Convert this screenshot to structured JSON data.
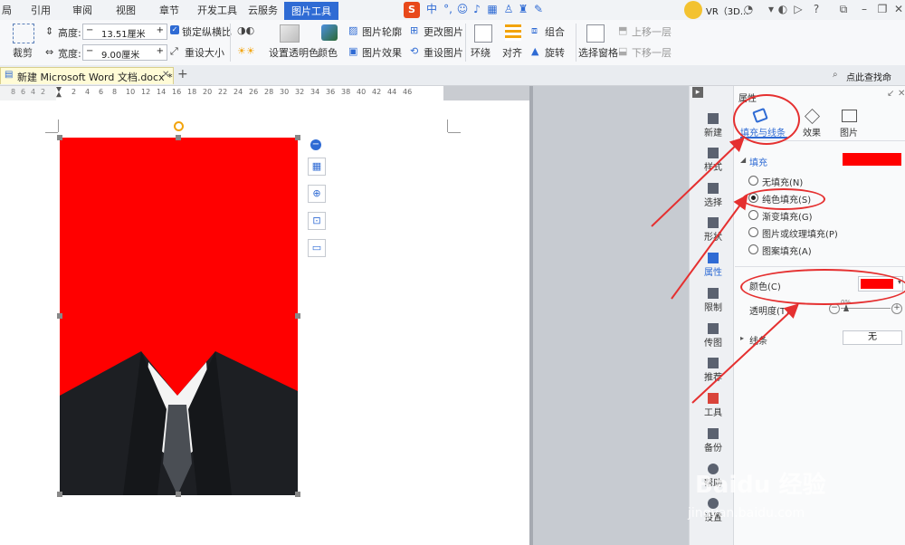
{
  "tabs": [
    "局",
    "引用",
    "审阅",
    "视图",
    "章节",
    "开发工具",
    "云服务",
    "图片工具"
  ],
  "active_tab": "图片工具",
  "user": "VR（3D...",
  "ribbon": {
    "crop": "裁剪",
    "height_label": "高度:",
    "height_value": "13.51厘米",
    "width_label": "宽度:",
    "width_value": "9.00厘米",
    "lock_ratio": "锁定纵横比",
    "reset_size": "重设大小",
    "transparent_color": "设置透明色",
    "color": "颜色",
    "outline": "图片轮廓",
    "effects": "图片效果",
    "change_picture": "更改图片",
    "reset_picture": "重设图片",
    "wrap": "环绕",
    "align": "对齐",
    "group": "组合",
    "rotate": "旋转",
    "selection_pane": "选择窗格",
    "bring_forward": "上移一层",
    "send_backward": "下移一层",
    "search": "点此查找命"
  },
  "doc_tab": "新建 Microsoft Word 文档.docx *",
  "ruler": [
    "8",
    "6",
    "4",
    "2",
    "",
    "2",
    "4",
    "6",
    "8",
    "10",
    "12",
    "14",
    "16",
    "18",
    "20",
    "22",
    "24",
    "26",
    "28",
    "30",
    "32",
    "34",
    "36",
    "38",
    "40",
    "42",
    "44",
    "46"
  ],
  "side_buttons": [
    "新建",
    "样式",
    "选择",
    "形状",
    "属性",
    "限制",
    "传图",
    "推荐",
    "工具",
    "备份",
    "帮助",
    "设置"
  ],
  "pane": {
    "title": "属性",
    "tab_fill_line": "填充与线条",
    "tab_effects": "效果",
    "tab_picture": "图片",
    "fill_section": "填充",
    "options": [
      "无填充(N)",
      "纯色填充(S)",
      "渐变填充(G)",
      "图片或纹理填充(P)",
      "图案填充(A)"
    ],
    "selected_option": 1,
    "color_label": "颜色(C)",
    "transparency_label": "透明度(T)",
    "transparency_value": "0%",
    "line_section": "线条",
    "line_value": "无"
  },
  "colors": {
    "fill": "#ff0000",
    "accent": "#2f6bd4",
    "annotation": "#e53030"
  },
  "watermark": "Baidu 经验",
  "watermark_url": "jingyan.baidu.com"
}
